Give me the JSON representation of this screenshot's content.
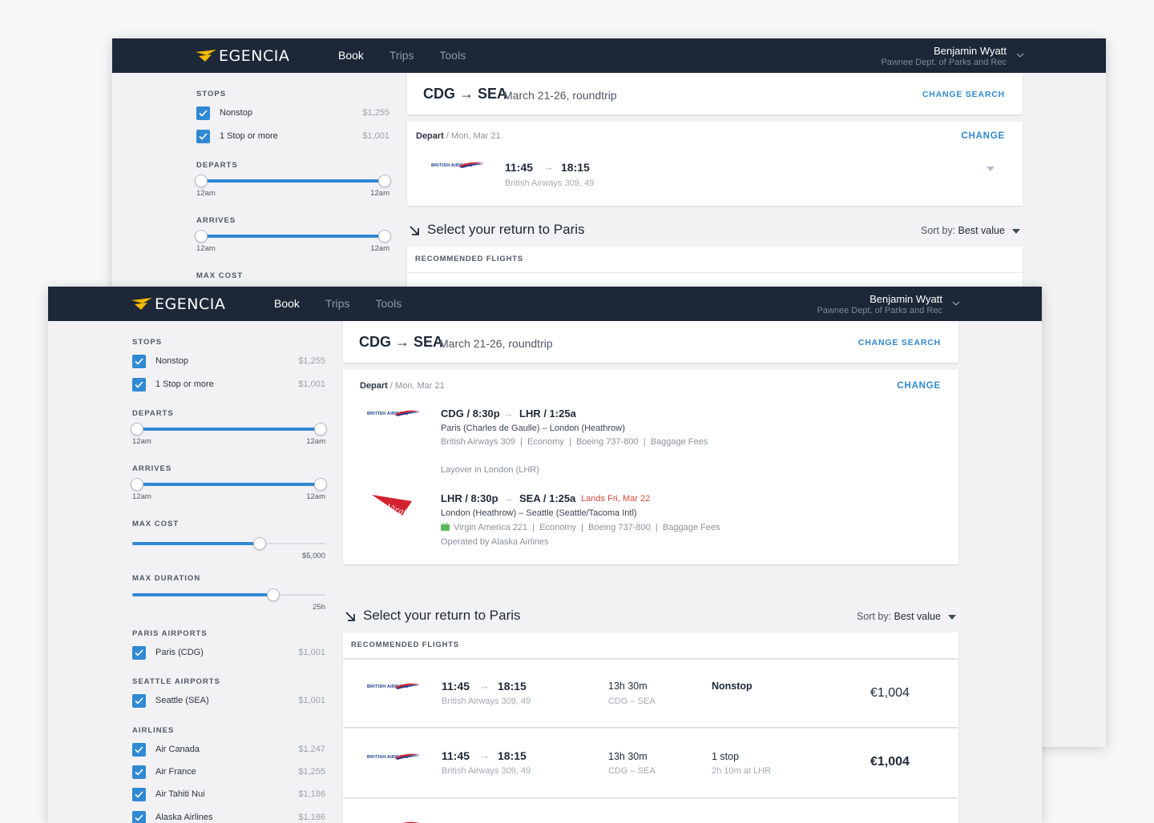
{
  "brand": {
    "name": "EGENCIA",
    "accent": "#3089d3",
    "navbar": "#1c2837",
    "logo_color": "#f5b800"
  },
  "nav": {
    "book": "Book",
    "trips": "Trips",
    "tools": "Tools"
  },
  "user": {
    "name": "Benjamin Wyatt",
    "org": "Pawnee Dept. of Parks and Rec"
  },
  "search": {
    "route": "CDG → SEA",
    "dates": "March 21-26, roundtrip",
    "change_search": "CHANGE SEARCH"
  },
  "filters": {
    "stops_title": "STOPS",
    "stops": [
      {
        "label": "Nonstop",
        "price": "$1,255",
        "checked": true
      },
      {
        "label": "1 Stop or more",
        "price": "$1,001",
        "checked": true
      }
    ],
    "departs_title": "DEPARTS",
    "departs": {
      "min": "12am",
      "max": "12am"
    },
    "arrives_title": "ARRIVES",
    "arrives": {
      "min": "12am",
      "max": "12am"
    },
    "max_cost_title": "MAX COST",
    "max_cost": {
      "label": "$5,000",
      "level": 0.66
    },
    "max_duration_title": "MAX DURATION",
    "max_duration": {
      "label": "25h",
      "level": 0.73
    },
    "paris_title": "PARIS AIRPORTS",
    "paris": [
      {
        "label": "Paris (CDG)",
        "price": "$1,001"
      }
    ],
    "seattle_title": "SEATTLE AIRPORTS",
    "seattle": [
      {
        "label": "Seattle (SEA)",
        "price": "$1,001"
      }
    ],
    "airlines_title": "AIRLINES",
    "airlines": [
      {
        "label": "Air Canada",
        "price": "$1,247"
      },
      {
        "label": "Air France",
        "price": "$1,255"
      },
      {
        "label": "Air Tahiti Nui",
        "price": "$1,186"
      },
      {
        "label": "Alaska Airlines",
        "price": "$1,186"
      }
    ]
  },
  "depart": {
    "label": "Depart",
    "date": " / Mon, Mar 21",
    "change": "CHANGE",
    "collapsed": {
      "dep_time": "11:45",
      "arr_time": "18:15",
      "flights": "British Airways 309, 49",
      "airline_logo": "BRITISH AIRWAYS"
    },
    "leg1": {
      "airline_logo": "BRITISH AIRWAYS",
      "from": "CDG / 8:30p",
      "to": "LHR / 1:25a",
      "airports": "Paris (Charles de Gaulle) – London (Heathrow)",
      "details": "British Airways 309  |  Economy  |  Boeing 737-800  |  Baggage Fees"
    },
    "layover": "Layover in London (LHR)",
    "leg2": {
      "airline_logo": "Virgin",
      "from": "LHR / 8:30p",
      "to": "SEA / 1:25a",
      "lands": "Lands Fri, Mar 22",
      "airports": "London (Heathrow) – Seattle (Seattle/Tacoma Intl)",
      "details": "Virgin America 221  |  Economy  |  Boeing 737-800  |  Baggage Fees",
      "operated": "Operated by Alaska Airlines"
    }
  },
  "return": {
    "title": "Select your return to Paris",
    "sort_label": "Sort by: ",
    "sort_value": "Best value",
    "recommended": "RECOMMENDED FLIGHTS",
    "results": [
      {
        "airline_logo": "BRITISH AIRWAYS",
        "dep": "11:45",
        "arr": "18:15",
        "flights": "British Airways 309, 49",
        "duration": "13h 30m",
        "route": "CDG – SEA",
        "stops": "Nonstop",
        "stops_detail": "",
        "price": "€1,004"
      },
      {
        "airline_logo": "BRITISH AIRWAYS",
        "dep": "11:45",
        "arr": "18:15",
        "flights": "British Airways 309, 49",
        "duration": "13h 30m",
        "route": "CDG – SEA",
        "stops": "1 stop",
        "stops_detail": "2h 10m at LHR",
        "price": "€1,004"
      }
    ]
  }
}
